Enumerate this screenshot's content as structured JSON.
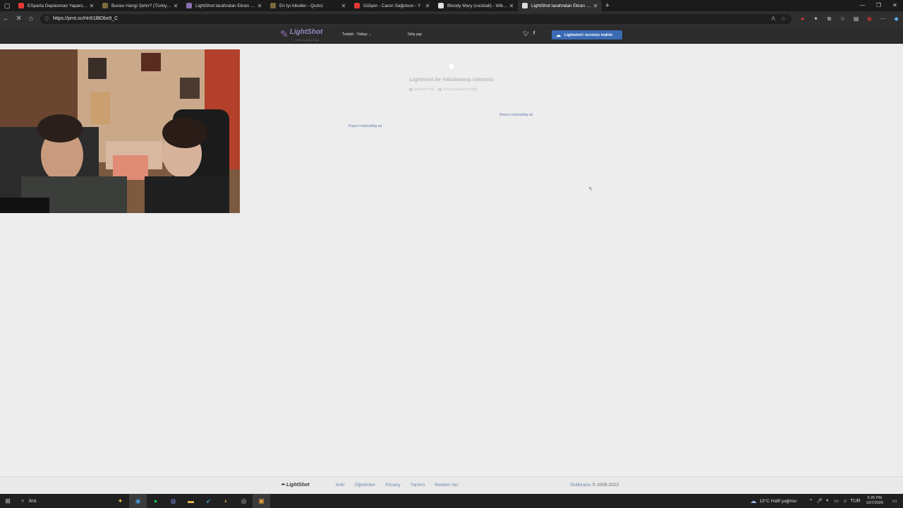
{
  "browser": {
    "tabs": [
      {
        "title": "ESparta Deplasman Yaparsa ( abi",
        "favicon_color": "#e53935"
      },
      {
        "title": "Burası Hangi Şehir? (Türkiye) - Qu",
        "favicon_color": "#7a6b3a"
      },
      {
        "title": "LightShot tarafından Ekran Görünt",
        "favicon_color": "#8a6fb0"
      },
      {
        "title": "En İyi Alkoller - Quizci",
        "favicon_color": "#7a6b3a"
      },
      {
        "title": "Gülşen - Canın Sağolsun - Y",
        "favicon_color": "#e53935"
      },
      {
        "title": "Bloody Mary (cocktail) - Wikipedi",
        "favicon_color": "#dddddd"
      },
      {
        "title": "LightShot tarafından Ekran Görün",
        "favicon_color": "#dddddd"
      }
    ],
    "active_tab_index": 6,
    "url": "https://prnt.sc/Hn51lBDbx9_C"
  },
  "lightshot": {
    "logo_name": "LightShot",
    "logo_tagline": "screen capture tool",
    "language": "Turkish - Türkçe",
    "login": "Giriş yap",
    "download_button": "Lightshot'ı ücretsiz indirin",
    "screenshot_title": "Lightshot ile Yakalanmış Görüntü",
    "similar_link": "benzerini bul",
    "report_link": "kötüye kullanımı bildir",
    "report_misleading_1": "Report misleading ad",
    "report_misleading_2": "Report misleading ad"
  },
  "footer": {
    "logo": "LightShot",
    "links": [
      "İndir",
      "Öğreticiler",
      "Privacy",
      "Yardım",
      "Reklam Ver"
    ],
    "brand": "Skillbrains",
    "copyright": "© 2009-2022"
  },
  "taskbar": {
    "search_placeholder": "Ara",
    "weather": "13°C  Hafif yağmur",
    "lang": "TUR",
    "time": "5:25 PM",
    "date": "10/7/2025"
  }
}
